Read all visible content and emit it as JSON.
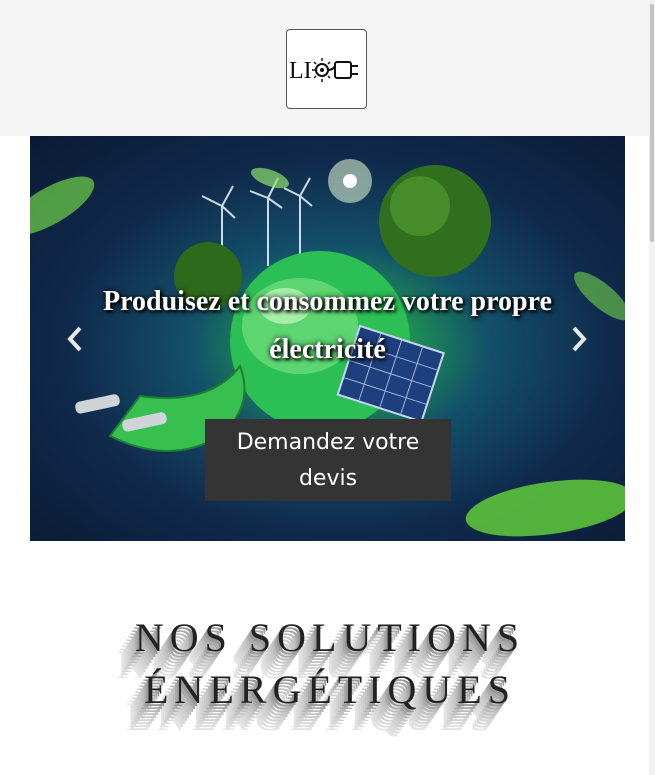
{
  "header": {
    "logo_text": "LI"
  },
  "carousel": {
    "headline": "Produisez et consommez votre propre électricité",
    "cta_label": "Demandez votre devis",
    "prev_icon": "chevron-left-icon",
    "next_icon": "chevron-right-icon"
  },
  "solutions": {
    "title": "NOS SOLUTIONS ÉNERGÉTIQUES"
  },
  "colors": {
    "header_bg": "#f5f5f6",
    "cta_bg": "#343434",
    "hero_green": "#4ce06a",
    "hero_navy": "#102a4c"
  }
}
